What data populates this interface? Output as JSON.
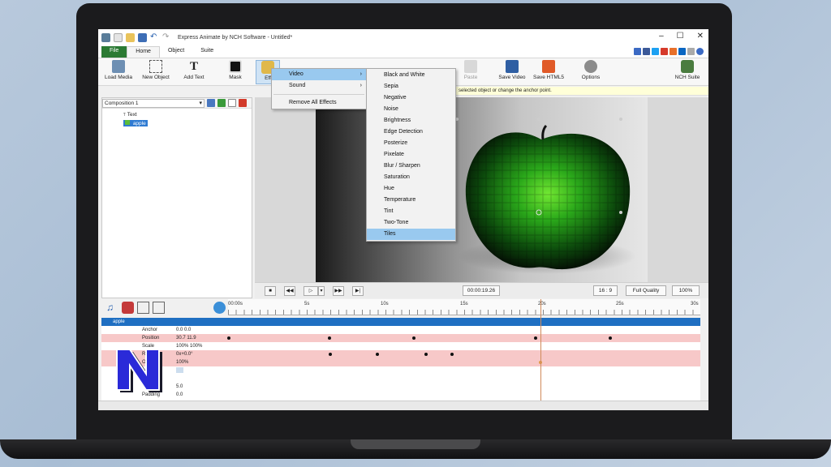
{
  "window": {
    "title": "Express Animate by NCH Software - Untitled*",
    "controls": [
      "–",
      "☐",
      "✕"
    ]
  },
  "menubar": {
    "tabs": [
      "File",
      "Home",
      "Object",
      "Suite"
    ],
    "active": "Home"
  },
  "ribbon": {
    "buttons": [
      {
        "label": "Load Media",
        "icon": "load-media-icon"
      },
      {
        "label": "New Object",
        "icon": "new-object-icon"
      },
      {
        "label": "Add Text",
        "icon": "add-text-icon"
      },
      {
        "label": "Mask",
        "icon": "mask-icon"
      },
      {
        "label": "Eff",
        "icon": "effects-icon"
      },
      {
        "label": "Paste",
        "icon": "paste-icon"
      },
      {
        "label": "Save Video",
        "icon": "save-video-icon"
      },
      {
        "label": "Save HTML5",
        "icon": "save-html5-icon"
      },
      {
        "label": "Options",
        "icon": "options-icon"
      },
      {
        "label": "NCH Suite",
        "icon": "nch-suite-icon"
      }
    ],
    "hint": "selected object or change the anchor point."
  },
  "composition": {
    "selected": "Composition 1",
    "tree": [
      {
        "label": "Text"
      },
      {
        "label": "apple"
      }
    ]
  },
  "effects_menu": {
    "items": [
      "Video",
      "Sound",
      "Remove All Effects"
    ],
    "highlighted": "Video"
  },
  "video_submenu": {
    "items": [
      "Black and White",
      "Sepia",
      "Negative",
      "Noise",
      "Brightness",
      "Edge Detection",
      "Posterize",
      "Pixelate",
      "Blur / Sharpen",
      "Saturation",
      "Hue",
      "Temperature",
      "Tint",
      "Two-Tone",
      "Tiles"
    ],
    "highlighted": "Tiles"
  },
  "playback": {
    "time": "00:00:19.26",
    "aspect": "16 : 9",
    "quality": "Full Quality",
    "zoom": "100%"
  },
  "timeline": {
    "ticks": [
      "00:00s",
      "5s",
      "10s",
      "15s",
      "20s",
      "25s",
      "30s"
    ],
    "layer": "apple",
    "properties": [
      {
        "name": "Anchor",
        "value": "0.0  0.0"
      },
      {
        "name": "Position",
        "value": "30.7  11.9"
      },
      {
        "name": "Scale",
        "value": "100%  100%"
      },
      {
        "name": "Rotation",
        "value": "0x+0.0°"
      },
      {
        "name": "Opacity",
        "value": "100%"
      },
      {
        "name": "",
        "value": ""
      },
      {
        "name": "",
        "value": ""
      },
      {
        "name": "",
        "value": "5.0"
      },
      {
        "name": "",
        "value": "0.0"
      },
      {
        "name": "Padding",
        "value": "0.0"
      }
    ]
  },
  "colors": {
    "file_tab": "#2b7a33",
    "menu_highlight": "#99c9ef",
    "track_highlight": "#f7c8c8",
    "layer_bar": "#1f6fc2",
    "playhead": "#d08a5a"
  }
}
